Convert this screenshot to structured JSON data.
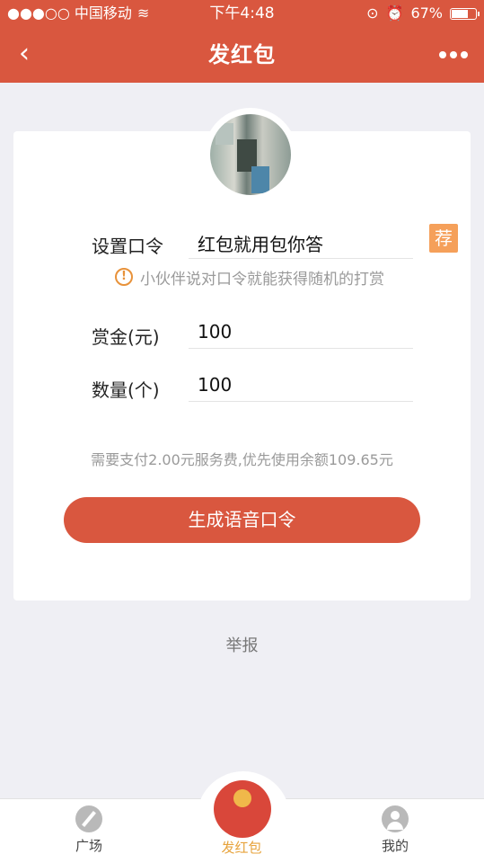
{
  "status_bar": {
    "carrier": "●●●○○ 中国移动",
    "time": "下午4:48",
    "battery": "67%",
    "battery_level": 0.67
  },
  "nav": {
    "back_icon": "chevron-left-icon",
    "title": "发红包",
    "more_icon": "more-dots-icon"
  },
  "form": {
    "password_label": "设置口令",
    "password_value": "红包就用包你答",
    "recommend_label": "荐",
    "hint": "小伙伴说对口令就能获得随机的打赏",
    "reward_label": "赏金(元)",
    "reward_value": "100",
    "count_label": "数量(个)",
    "count_value": "100",
    "fee_note": "需要支付2.00元服务费,优先使用余额109.65元",
    "submit_label": "生成语音口令"
  },
  "report_label": "举报",
  "tabbar": {
    "items": [
      {
        "label": "广场",
        "icon": "compass-icon"
      },
      {
        "label": "发红包",
        "icon": "red-envelope-icon"
      },
      {
        "label": "我的",
        "icon": "profile-icon"
      }
    ]
  },
  "colors": {
    "brand": "#d9573f",
    "accent": "#f5a05a"
  }
}
